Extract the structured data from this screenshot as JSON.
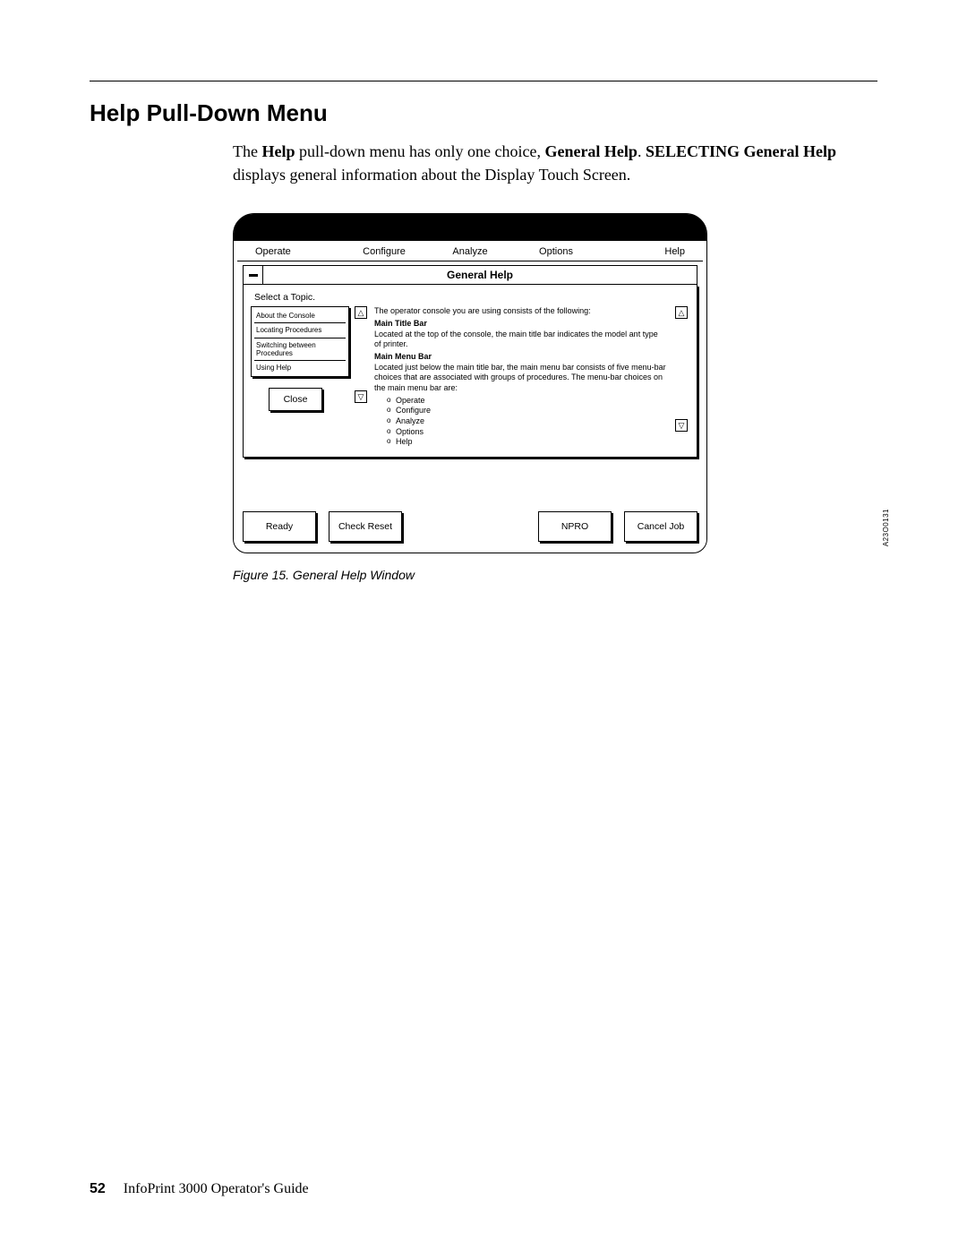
{
  "section": {
    "title": "Help Pull-Down Menu"
  },
  "intro": {
    "t1": "The ",
    "b1": "Help",
    "t2": " pull-down menu has only one choice, ",
    "b2": "General Help",
    "t3": ". ",
    "b3": "SELECTING General Help",
    "t4": " displays general information about the Display Touch Screen."
  },
  "menubar": {
    "m1": "Operate",
    "m2": "Configure",
    "m3": "Analyze",
    "m4": "Options",
    "m5": "Help"
  },
  "dialog": {
    "title": "General Help",
    "select_label": "Select a Topic.",
    "topics": [
      "About the Console",
      "Locating Procedures",
      "Switching between Procedures",
      "Using Help"
    ],
    "close": "Close",
    "content": {
      "line1": "The operator console you are using consists of the following:",
      "h1": "Main Title Bar",
      "line2": "Located at the top of the console, the main title bar indicates the model ant type of printer.",
      "h2": "Main Menu Bar",
      "line3": "Located just below the main title bar, the main menu bar consists of five menu-bar choices that are associated with groups of procedures. The menu-bar choices on the main menu bar are:",
      "items": [
        "Operate",
        "Configure",
        "Analyze",
        "Options",
        "Help"
      ]
    }
  },
  "scroll": {
    "up": "△",
    "down": "▽"
  },
  "footer_buttons": {
    "ready": "Ready",
    "check_reset": "Check Reset",
    "npro": "NPRO",
    "cancel_job": "Cancel Job"
  },
  "figure": {
    "code": "A23O0131",
    "caption": "Figure 15. General Help Window"
  },
  "page_footer": {
    "page_no": "52",
    "title": "InfoPrint 3000 Operator's Guide"
  }
}
